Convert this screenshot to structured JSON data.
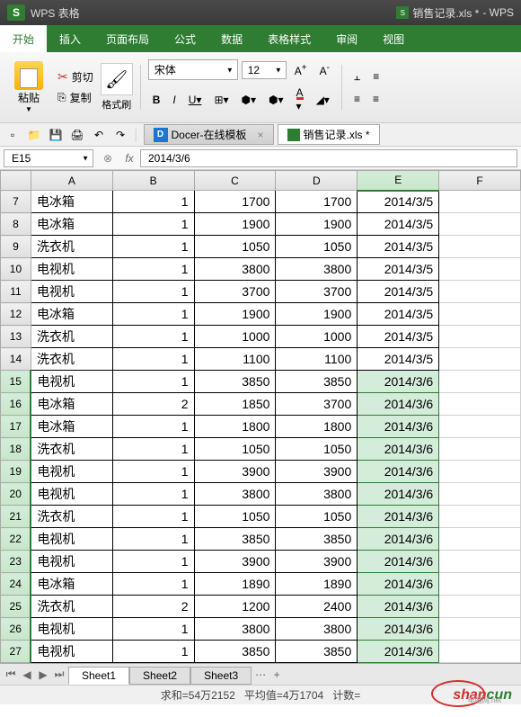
{
  "titleBar": {
    "logo": "S",
    "appName": "WPS 表格",
    "docTitle": "销售记录.xls *",
    "appSuffix": "- WPS"
  },
  "menu": {
    "items": [
      "开始",
      "插入",
      "页面布局",
      "公式",
      "数据",
      "表格样式",
      "审阅",
      "视图"
    ],
    "activeIndex": 0
  },
  "ribbon": {
    "paste": "粘贴",
    "cut": "剪切",
    "copy": "复制",
    "formatPainter": "格式刷",
    "fontName": "宋体",
    "fontSize": "12"
  },
  "quickBar": {
    "docerTab": "Docer-在线模板",
    "fileTab": "销售记录.xls *"
  },
  "formulaBar": {
    "cellRef": "E15",
    "value": "2014/3/6"
  },
  "columns": [
    "A",
    "B",
    "C",
    "D",
    "E",
    "F"
  ],
  "selectedCol": 4,
  "rows": [
    {
      "n": 7,
      "a": "电冰箱",
      "b": 1,
      "c": 1700,
      "d": 1700,
      "e": "2014/3/5",
      "sel": false
    },
    {
      "n": 8,
      "a": "电冰箱",
      "b": 1,
      "c": 1900,
      "d": 1900,
      "e": "2014/3/5",
      "sel": false
    },
    {
      "n": 9,
      "a": "洗衣机",
      "b": 1,
      "c": 1050,
      "d": 1050,
      "e": "2014/3/5",
      "sel": false
    },
    {
      "n": 10,
      "a": "电视机",
      "b": 1,
      "c": 3800,
      "d": 3800,
      "e": "2014/3/5",
      "sel": false
    },
    {
      "n": 11,
      "a": "电视机",
      "b": 1,
      "c": 3700,
      "d": 3700,
      "e": "2014/3/5",
      "sel": false
    },
    {
      "n": 12,
      "a": "电冰箱",
      "b": 1,
      "c": 1900,
      "d": 1900,
      "e": "2014/3/5",
      "sel": false
    },
    {
      "n": 13,
      "a": "洗衣机",
      "b": 1,
      "c": 1000,
      "d": 1000,
      "e": "2014/3/5",
      "sel": false
    },
    {
      "n": 14,
      "a": "洗衣机",
      "b": 1,
      "c": 1100,
      "d": 1100,
      "e": "2014/3/5",
      "sel": false
    },
    {
      "n": 15,
      "a": "电视机",
      "b": 1,
      "c": 3850,
      "d": 3850,
      "e": "2014/3/6",
      "sel": true
    },
    {
      "n": 16,
      "a": "电冰箱",
      "b": 2,
      "c": 1850,
      "d": 3700,
      "e": "2014/3/6",
      "sel": true
    },
    {
      "n": 17,
      "a": "电冰箱",
      "b": 1,
      "c": 1800,
      "d": 1800,
      "e": "2014/3/6",
      "sel": true
    },
    {
      "n": 18,
      "a": "洗衣机",
      "b": 1,
      "c": 1050,
      "d": 1050,
      "e": "2014/3/6",
      "sel": true
    },
    {
      "n": 19,
      "a": "电视机",
      "b": 1,
      "c": 3900,
      "d": 3900,
      "e": "2014/3/6",
      "sel": true
    },
    {
      "n": 20,
      "a": "电视机",
      "b": 1,
      "c": 3800,
      "d": 3800,
      "e": "2014/3/6",
      "sel": true
    },
    {
      "n": 21,
      "a": "洗衣机",
      "b": 1,
      "c": 1050,
      "d": 1050,
      "e": "2014/3/6",
      "sel": true
    },
    {
      "n": 22,
      "a": "电视机",
      "b": 1,
      "c": 3850,
      "d": 3850,
      "e": "2014/3/6",
      "sel": true
    },
    {
      "n": 23,
      "a": "电视机",
      "b": 1,
      "c": 3900,
      "d": 3900,
      "e": "2014/3/6",
      "sel": true
    },
    {
      "n": 24,
      "a": "电冰箱",
      "b": 1,
      "c": 1890,
      "d": 1890,
      "e": "2014/3/6",
      "sel": true
    },
    {
      "n": 25,
      "a": "洗衣机",
      "b": 2,
      "c": 1200,
      "d": 2400,
      "e": "2014/3/6",
      "sel": true
    },
    {
      "n": 26,
      "a": "电视机",
      "b": 1,
      "c": 3800,
      "d": 3800,
      "e": "2014/3/6",
      "sel": true
    },
    {
      "n": 27,
      "a": "电视机",
      "b": 1,
      "c": 3850,
      "d": 3850,
      "e": "2014/3/6",
      "sel": true
    }
  ],
  "sheetTabs": {
    "tabs": [
      "Sheet1",
      "Sheet2",
      "Sheet3"
    ],
    "activeIndex": 0,
    "addLabel": "+"
  },
  "statusBar": {
    "sum": "求和=54万2152",
    "avg": "平均值=4万1704",
    "count": "计数=",
    "watermark1": "shan",
    "watermark2": "cun"
  }
}
